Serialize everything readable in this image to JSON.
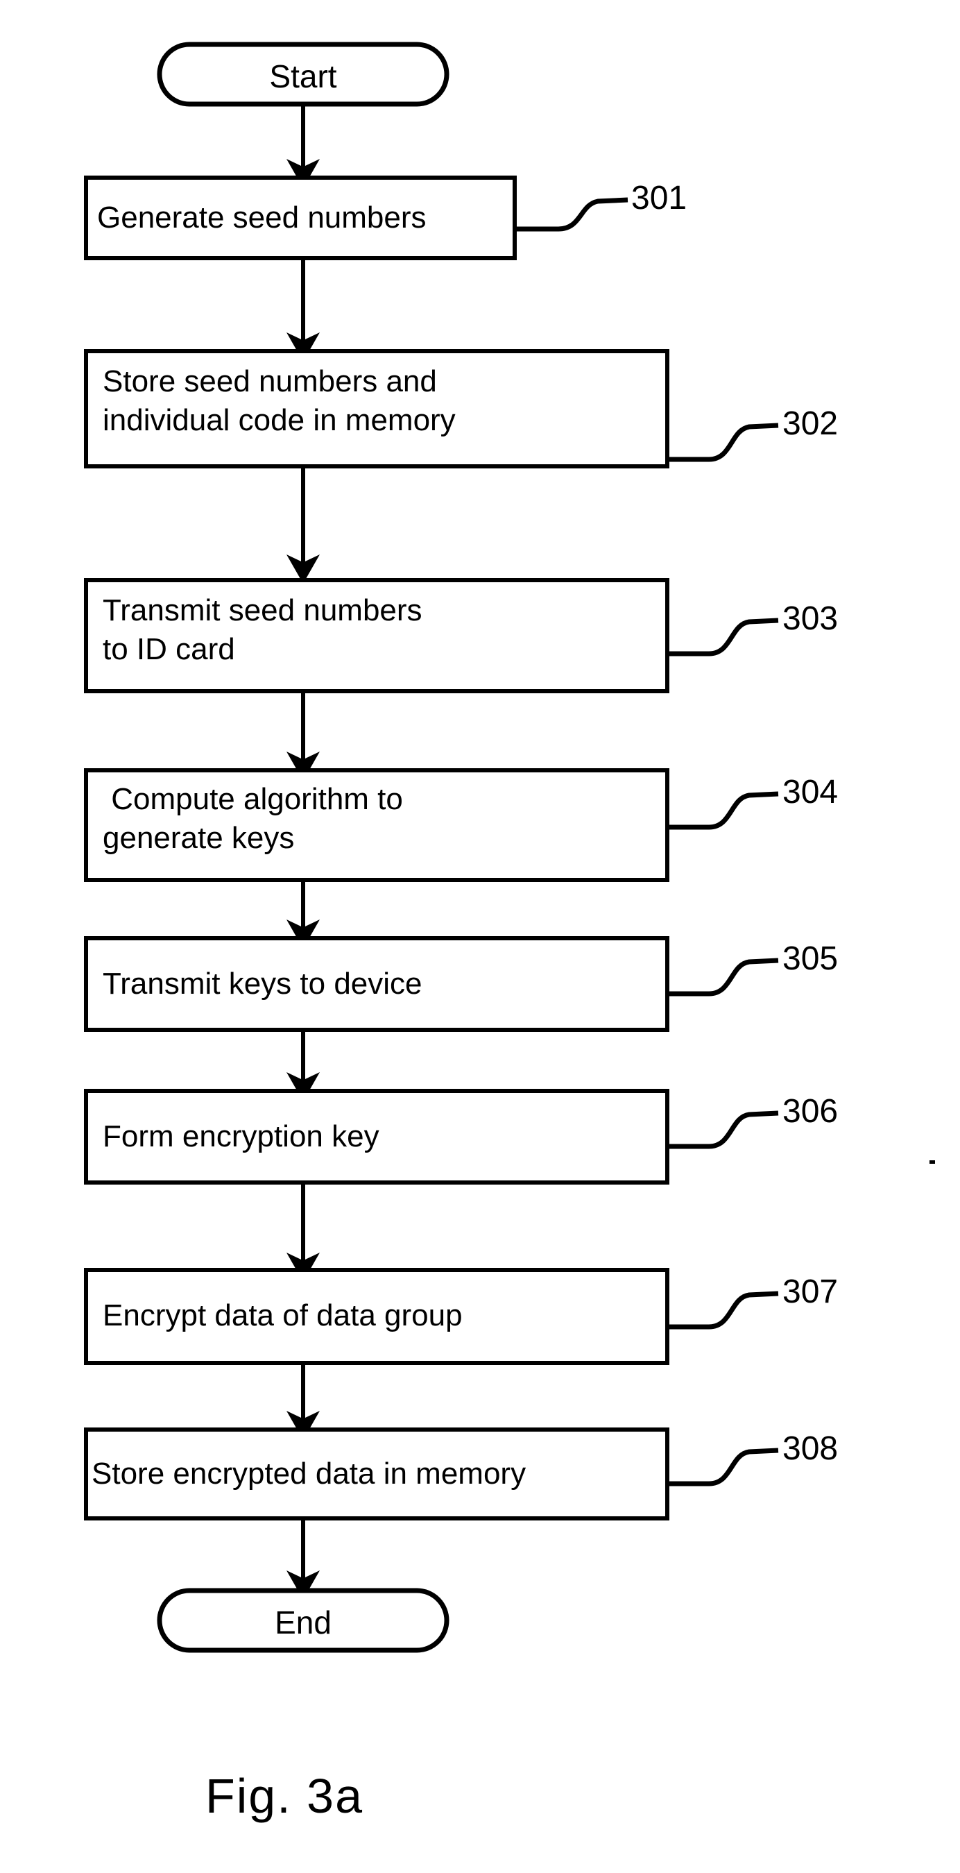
{
  "figure": {
    "caption": "Fig. 3a",
    "type": "flowchart",
    "orientation": "top-to-bottom",
    "line_color": "#000000",
    "background_color": "#ffffff"
  },
  "nodes": [
    {
      "id": "start",
      "shape": "terminator",
      "label": "Start",
      "lines": [
        "Start"
      ],
      "ref": null
    },
    {
      "id": "step-301",
      "shape": "process",
      "label": "Generate seed numbers",
      "lines": [
        "Generate seed numbers"
      ],
      "ref": "301"
    },
    {
      "id": "step-302",
      "shape": "process",
      "label": "Store seed numbers and individual code in memory",
      "lines": [
        "Store seed numbers and",
        "individual code in memory"
      ],
      "ref": "302"
    },
    {
      "id": "step-303",
      "shape": "process",
      "label": "Transmit seed numbers to ID card",
      "lines": [
        "Transmit seed numbers",
        "to ID card"
      ],
      "ref": "303"
    },
    {
      "id": "step-304",
      "shape": "process",
      "label": "Compute algorithm to generate keys",
      "lines": [
        " Compute algorithm to",
        "generate keys"
      ],
      "ref": "304"
    },
    {
      "id": "step-305",
      "shape": "process",
      "label": "Transmit keys to device",
      "lines": [
        "Transmit keys to device"
      ],
      "ref": "305"
    },
    {
      "id": "step-306",
      "shape": "process",
      "label": "Form encryption key",
      "lines": [
        "Form encryption key"
      ],
      "ref": "306"
    },
    {
      "id": "step-307",
      "shape": "process",
      "label": "Encrypt data of data group",
      "lines": [
        "Encrypt data of data group"
      ],
      "ref": "307"
    },
    {
      "id": "step-308",
      "shape": "process",
      "label": "Store encrypted data in memory",
      "lines": [
        "Store encrypted data in memory"
      ],
      "ref": "308"
    },
    {
      "id": "end",
      "shape": "terminator",
      "label": "End",
      "lines": [
        "End"
      ],
      "ref": null
    }
  ],
  "reference_numerals": [
    "301",
    "302",
    "303",
    "304",
    "305",
    "306",
    "307",
    "308"
  ],
  "edges": [
    {
      "from": "start",
      "to": "step-301",
      "arrow": true
    },
    {
      "from": "step-301",
      "to": "step-302",
      "arrow": true
    },
    {
      "from": "step-302",
      "to": "step-303",
      "arrow": true
    },
    {
      "from": "step-303",
      "to": "step-304",
      "arrow": true
    },
    {
      "from": "step-304",
      "to": "step-305",
      "arrow": true
    },
    {
      "from": "step-305",
      "to": "step-306",
      "arrow": true
    },
    {
      "from": "step-306",
      "to": "step-307",
      "arrow": true
    },
    {
      "from": "step-307",
      "to": "step-308",
      "arrow": true
    },
    {
      "from": "step-308",
      "to": "end",
      "arrow": true
    }
  ]
}
